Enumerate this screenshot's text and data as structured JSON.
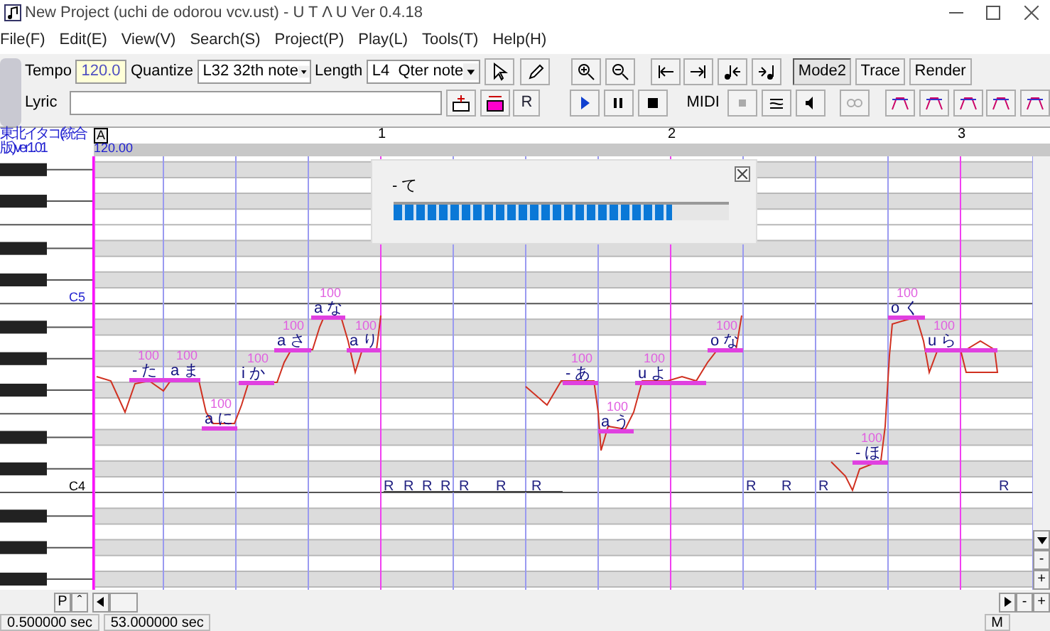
{
  "window": {
    "title": "New Project (uchi de odorou vcv.ust) - U T Λ U Ver 0.4.18"
  },
  "menu": [
    "File(F)",
    "Edit(E)",
    "View(V)",
    "Search(S)",
    "Project(P)",
    "Play(L)",
    "Tools(T)",
    "Help(H)"
  ],
  "toolbar": {
    "tempo_label": "Tempo",
    "tempo": "120.0",
    "quantize_label": "Quantize",
    "quantize": "L32 32th note",
    "length_label": "Length",
    "length": "L4  Qter note",
    "lyric_label": "Lyric",
    "rest_button": "R",
    "midi_label": "MIDI",
    "mode_buttons": [
      {
        "label": "Mode2",
        "selected": true
      },
      {
        "label": "Trace",
        "selected": false
      },
      {
        "label": "Render",
        "selected": false
      }
    ]
  },
  "voicebank": {
    "name_lines": [
      "東北イタコ(統合",
      "版)ver1.01"
    ]
  },
  "ruler": {
    "marker": "A",
    "tempo": "120.00",
    "measures": [
      "1",
      "2",
      "3"
    ]
  },
  "keyboard": {
    "labels": [
      "C5",
      "C4"
    ]
  },
  "notes": [
    {
      "lyric": "- た",
      "velocity": "100"
    },
    {
      "lyric": "a ま",
      "velocity": "100"
    },
    {
      "lyric": "a に",
      "velocity": "100"
    },
    {
      "lyric": "i か",
      "velocity": "100"
    },
    {
      "lyric": "a さ",
      "velocity": "100"
    },
    {
      "lyric": "a な",
      "velocity": "100"
    },
    {
      "lyric": "a り",
      "velocity": "100"
    },
    {
      "lyric": "- あ",
      "velocity": "100"
    },
    {
      "lyric": "a う",
      "velocity": "100"
    },
    {
      "lyric": "u よ",
      "velocity": "100"
    },
    {
      "lyric": "o な",
      "velocity": "100"
    },
    {
      "lyric": "- ほ",
      "velocity": "100"
    },
    {
      "lyric": "o く",
      "velocity": "100"
    },
    {
      "lyric": "u ら",
      "velocity": "100"
    }
  ],
  "rests": [
    "R",
    "R",
    "R",
    "R",
    "R",
    "R",
    "R",
    "R",
    "R",
    "R",
    "R"
  ],
  "render_dialog": {
    "lyric": "- て",
    "level": 0.83
  },
  "bottom_bar": {
    "p_button": "P",
    "up_button": "ˆ",
    "minus_button": "-",
    "plus_button": "+"
  },
  "status_bar": [
    "0.500000 sec",
    "53.000000 sec",
    "M"
  ]
}
